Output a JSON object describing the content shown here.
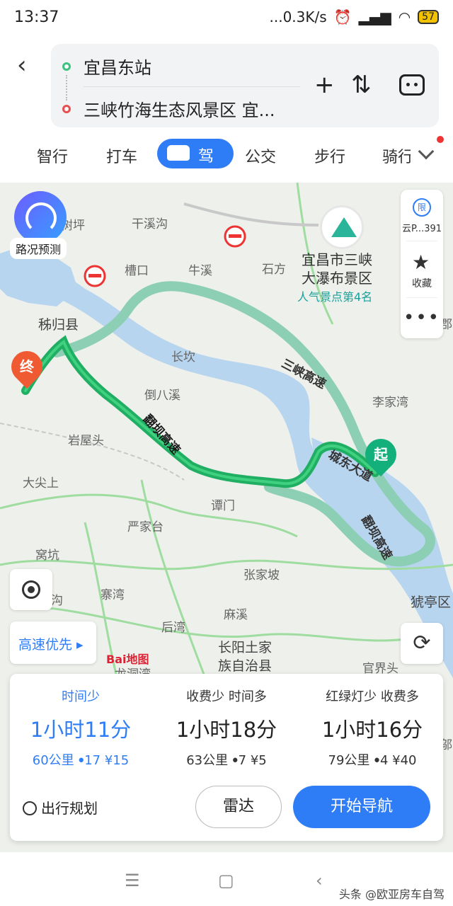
{
  "status": {
    "time": "13:37",
    "speed": "...0.3K/s",
    "battery": "57"
  },
  "route": {
    "from": "宜昌东站",
    "to": "三峡竹海生态风景区 宜..."
  },
  "modes": [
    "智行",
    "打车",
    "驾车",
    "公交",
    "步行",
    "骑行"
  ],
  "map": {
    "speed_label": "路况预测",
    "side": {
      "limit_icon": "限",
      "limit_text": "云P...391",
      "fav": "收藏"
    },
    "poi": {
      "name_line1": "宜昌市三峡",
      "name_line2": "大瀑布景区",
      "sub": "人气景点第4名"
    },
    "places": [
      "树坪",
      "干溪沟",
      "槽口",
      "牛溪",
      "石方",
      "秭归县",
      "长坎",
      "倒八溪",
      "岩屋头",
      "大尖上",
      "谭门",
      "严家台",
      "窝坑",
      "张家坡",
      "寨湾",
      "沟",
      "麻溪",
      "后湾",
      "长阳土家",
      "族自治县",
      "龙洞湾",
      "官界头",
      "李家湾",
      "猇亭区",
      "郡",
      "邬"
    ],
    "roads": {
      "r1": "三峡高速",
      "r2": "翻坝高速",
      "r3": "城东大道",
      "r4": "翻坝高速"
    },
    "pins": {
      "end": "终",
      "start": "起"
    },
    "highway_pref": "高速优先",
    "logo": "Bai地图"
  },
  "options": [
    {
      "tag": "时间少",
      "duration": "1小时11分",
      "distance": "60公里",
      "lights": "17",
      "fee": "¥15"
    },
    {
      "tag": "收费少 时间多",
      "duration": "1小时18分",
      "distance": "63公里",
      "lights": "7",
      "fee": "¥5"
    },
    {
      "tag": "红绿灯少 收费多",
      "duration": "1小时16分",
      "distance": "79公里",
      "lights": "4",
      "fee": "¥40"
    }
  ],
  "actions": {
    "plan": "出行规划",
    "radar": "雷达",
    "navigate": "开始导航"
  },
  "watermark": "头条 @欧亚房车自驾",
  "colors": {
    "accent": "#2f7df6",
    "route_main": "#1fae62",
    "route_alt": "#8ccfb4",
    "start": "#14b07b",
    "end": "#f05a32"
  }
}
